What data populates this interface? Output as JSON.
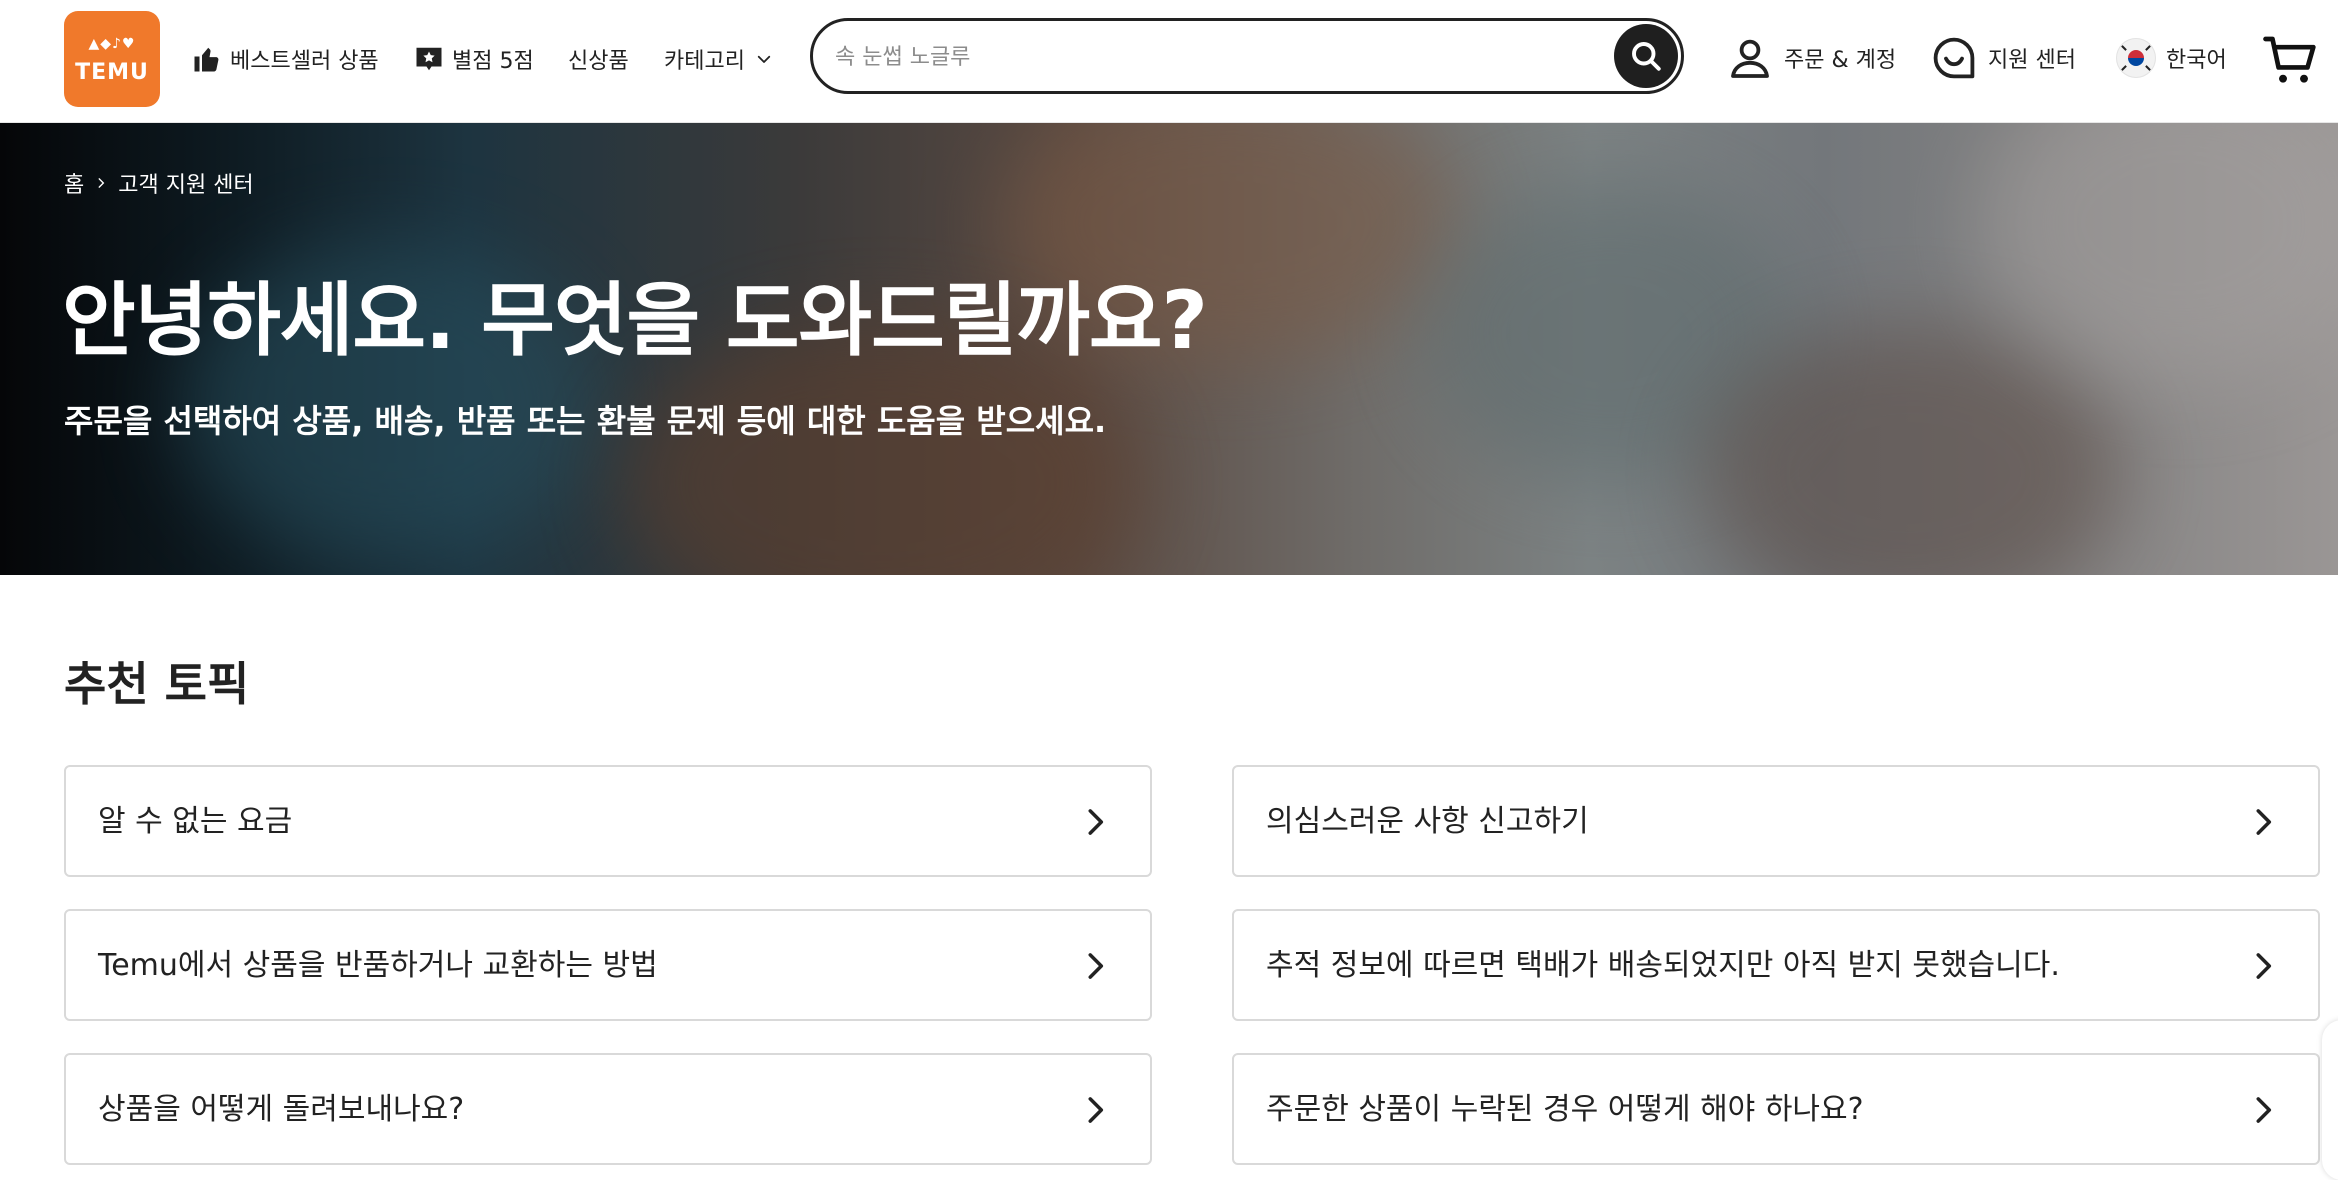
{
  "header": {
    "logo_text": "TEMU",
    "nav": [
      {
        "label": "베스트셀러 상품",
        "icon": "thumbs-up-icon"
      },
      {
        "label": "별점 5점",
        "icon": "star-badge-icon"
      },
      {
        "label": "신상품",
        "icon": ""
      },
      {
        "label": "카테고리",
        "icon": "chevron-down-icon"
      }
    ],
    "search": {
      "placeholder": "속 눈썹 노글루",
      "value": "",
      "button_icon": "search-icon"
    },
    "account_label": "주문 & 계정",
    "support_label": "지원 센터",
    "language_label": "한국어",
    "cart_icon": "cart-icon"
  },
  "hero": {
    "breadcrumb": [
      "홈",
      "고객 지원 센터"
    ],
    "title": "안녕하세요. 무엇을 도와드릴까요?",
    "subtitle": "주문을 선택하여 상품, 배송, 반품 또는 환불 문제 등에 대한 도움을 받으세요."
  },
  "topics": {
    "title": "추천 토픽",
    "items": [
      {
        "label": "알 수 없는 요금"
      },
      {
        "label": "의심스러운 사항 신고하기"
      },
      {
        "label": "Temu에서 상품을 반품하거나 교환하는 방법"
      },
      {
        "label": "추적 정보에 따르면 택배가 배송되었지만 아직 받지 못했습니다."
      },
      {
        "label": "상품을 어떻게 돌려보내나요?"
      },
      {
        "label": "주문한 상품이 누락된 경우 어떻게 해야 하나요?"
      }
    ]
  },
  "colors": {
    "brand": "#f0792b",
    "text": "#222222",
    "border": "#d9d9d9"
  }
}
